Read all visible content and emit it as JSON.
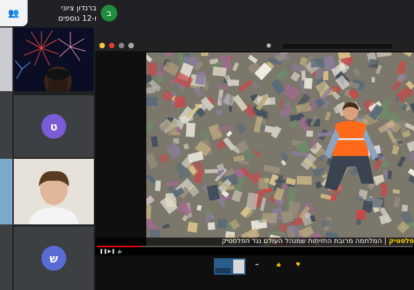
{
  "header": {
    "avatar_letter": "ב",
    "name": "ברנדון ציוני",
    "others": "ו-12 נוספים"
  },
  "top_card_icon": "people-icon",
  "participants": [
    {
      "initial": "ט",
      "color": "#7b5bd6"
    },
    {
      "initial": "ש",
      "color": "#5b6bd6"
    }
  ],
  "video": {
    "caption_brand": "פלסטיק",
    "caption_title": "המלחמה מרובת החזיתות שמנהל העולם נגד הפלסטיק",
    "progress": 0.14
  },
  "colors": {
    "meet_bg": "#202124",
    "accent_red": "#ff0000",
    "caption_yellow": "#ffd400"
  }
}
